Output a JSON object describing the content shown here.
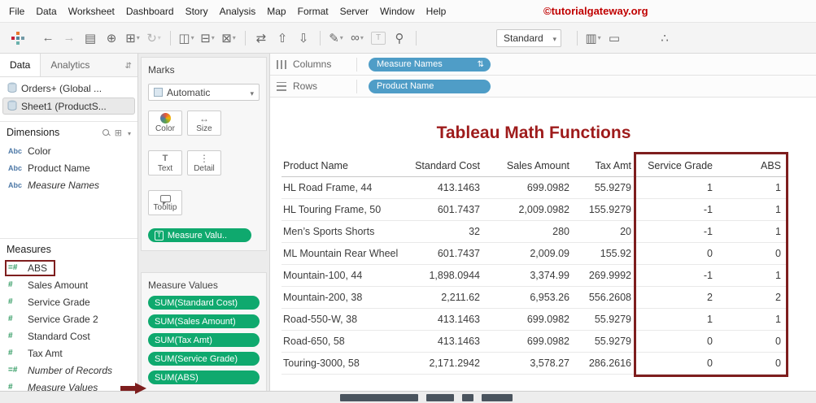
{
  "colors": {
    "accent-blue": "#4f9dc7",
    "accent-green": "#0fa96e",
    "brand-red": "#c00000",
    "maroon": "#7e1e1e",
    "title-red": "#9e1b1b"
  },
  "menubar": {
    "items": [
      "File",
      "Data",
      "Worksheet",
      "Dashboard",
      "Story",
      "Analysis",
      "Map",
      "Format",
      "Server",
      "Window",
      "Help"
    ],
    "watermark": "©tutorialgateway.org"
  },
  "toolbar": {
    "standard_dropdown": "Standard",
    "icons_left": [
      {
        "name": "back-icon",
        "glyph": "←"
      },
      {
        "name": "forward-icon",
        "glyph": "→",
        "dim": true
      },
      {
        "name": "save-icon",
        "glyph": "▤"
      },
      {
        "name": "add-data-source-icon",
        "glyph": "⊕"
      },
      {
        "name": "new-worksheet-icon",
        "glyph": "⊞",
        "caret": true
      },
      {
        "name": "refresh-icon",
        "glyph": "↻",
        "dim": true,
        "caret": true
      },
      {
        "name": "toolbar-separator",
        "sep": true,
        "inter": "false"
      },
      {
        "name": "new-dashboard-icon",
        "glyph": "◫",
        "caret": true
      },
      {
        "name": "new-story-icon",
        "glyph": "⊟",
        "caret": true
      },
      {
        "name": "clear-sheet-icon",
        "glyph": "⊠",
        "caret": true
      },
      {
        "name": "toolbar-separator",
        "sep": true,
        "inter": "false"
      },
      {
        "name": "swap-rows-columns-icon",
        "glyph": "⇄"
      },
      {
        "name": "sort-ascending-icon",
        "glyph": "⇧"
      },
      {
        "name": "sort-descending-icon",
        "glyph": "⇩"
      },
      {
        "name": "toolbar-separator",
        "sep": true,
        "inter": "false"
      },
      {
        "name": "highlight-icon",
        "glyph": "✎",
        "caret": true
      },
      {
        "name": "group-members-icon",
        "glyph": "∞",
        "caret": true
      },
      {
        "name": "show-mark-labels-icon",
        "glyph": "T",
        "boxed": true,
        "dim": true
      },
      {
        "name": "fix-axes-icon",
        "glyph": "⚲"
      },
      {
        "name": "toolbar-separator",
        "sep": true,
        "inter": "false"
      }
    ],
    "icons_right": [
      {
        "name": "toolbar-separator",
        "sep": true,
        "inter": "false"
      },
      {
        "name": "show-hide-cards-icon",
        "glyph": "▥",
        "caret": true
      },
      {
        "name": "presentation-mode-icon",
        "glyph": "▭"
      },
      {
        "name": "toolbar-spacer",
        "spacer": true,
        "inter": "false"
      },
      {
        "name": "share-icon",
        "glyph": "∴"
      }
    ]
  },
  "data_panel": {
    "tabs": [
      {
        "label": "Data",
        "active": true
      },
      {
        "label": "Analytics",
        "active": false
      }
    ],
    "sources": [
      {
        "name": "Orders+ (Global ...",
        "selected": false
      },
      {
        "name": "Sheet1 (ProductS...",
        "selected": true
      }
    ],
    "dimensions": {
      "header": "Dimensions",
      "items": [
        {
          "icon": "Abc",
          "name": "Color",
          "italic": false,
          "highlight": false
        },
        {
          "icon": "Abc",
          "name": "Product Name",
          "italic": false,
          "highlight": false
        },
        {
          "icon": "Abc",
          "name": "Measure Names",
          "italic": true,
          "highlight": false
        }
      ]
    },
    "measures": {
      "header": "Measures",
      "items": [
        {
          "icon": "=#",
          "name": "ABS",
          "italic": false,
          "highlight": true
        },
        {
          "icon": "#",
          "name": "Sales Amount",
          "italic": false,
          "highlight": false
        },
        {
          "icon": "#",
          "name": "Service Grade",
          "italic": false,
          "highlight": false
        },
        {
          "icon": "#",
          "name": "Service Grade 2",
          "italic": false,
          "highlight": false
        },
        {
          "icon": "#",
          "name": "Standard Cost",
          "italic": false,
          "highlight": false
        },
        {
          "icon": "#",
          "name": "Tax Amt",
          "italic": false,
          "highlight": false
        },
        {
          "icon": "=#",
          "name": "Number of Records",
          "italic": true,
          "highlight": false
        },
        {
          "icon": "#",
          "name": "Measure Values",
          "italic": true,
          "highlight": false
        }
      ]
    }
  },
  "marks_card": {
    "title": "Marks",
    "mark_type": "Automatic",
    "buttons": [
      {
        "name": "color-button",
        "label": "Color",
        "icon_name": "color-icon",
        "icon_class": "micon ic-color"
      },
      {
        "name": "size-button",
        "label": "Size",
        "icon_name": "size-icon",
        "icon_class": "micon ic-size"
      },
      {
        "name": "text-button",
        "label": "Text",
        "icon_name": "text-icon",
        "icon_class": "micon ic-text"
      },
      {
        "name": "detail-button",
        "label": "Detail",
        "icon_name": "detail-icon",
        "icon_class": "micon ic-detail"
      },
      {
        "name": "tooltip-button",
        "label": "Tooltip",
        "icon_name": "tooltip-icon",
        "icon_class": "micon ic-tooltip"
      }
    ],
    "pill": "Measure Valu.."
  },
  "measure_values_card": {
    "title": "Measure Values",
    "pills": [
      "SUM(Standard Cost)",
      "SUM(Sales Amount)",
      "SUM(Tax Amt)",
      "SUM(Service Grade)",
      "SUM(ABS)"
    ]
  },
  "shelves": {
    "columns_label": "Columns",
    "columns_pill": "Measure Names",
    "rows_label": "Rows",
    "rows_pill": "Product Name"
  },
  "chart_data": {
    "type": "table",
    "title": "Tableau Math Functions",
    "columns": [
      "Product Name",
      "Standard Cost",
      "Sales Amount",
      "Tax Amt",
      "Service Grade",
      "ABS"
    ],
    "rows": [
      [
        "HL Road Frame, 44",
        "413.1463",
        "699.0982",
        "55.9279",
        "1",
        "1"
      ],
      [
        "HL Touring Frame, 50",
        "601.7437",
        "2,009.0982",
        "155.9279",
        "-1",
        "1"
      ],
      [
        "Men’s Sports Shorts",
        "32",
        "280",
        "20",
        "-1",
        "1"
      ],
      [
        "ML Mountain Rear Wheel",
        "601.7437",
        "2,009.09",
        "155.92",
        "0",
        "0"
      ],
      [
        "Mountain-100, 44",
        "1,898.0944",
        "3,374.99",
        "269.9992",
        "-1",
        "1"
      ],
      [
        "Mountain-200, 38",
        "2,211.62",
        "6,953.26",
        "556.2608",
        "2",
        "2"
      ],
      [
        "Road-550-W, 38",
        "413.1463",
        "699.0982",
        "55.9279",
        "1",
        "1"
      ],
      [
        "Road-650, 58",
        "413.1463",
        "699.0982",
        "55.9279",
        "0",
        "0"
      ],
      [
        "Touring-3000, 58",
        "2,171.2942",
        "3,578.27",
        "286.2616",
        "0",
        "0"
      ]
    ],
    "highlighted_columns": [
      "Service Grade",
      "ABS"
    ]
  }
}
